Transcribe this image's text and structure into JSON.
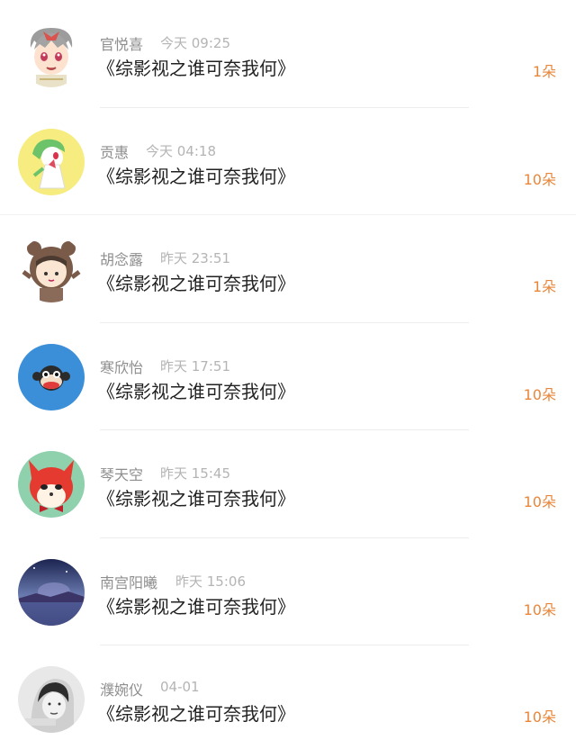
{
  "gifts": [
    {
      "name": "官悦喜",
      "time": "今天 09:25",
      "book": "《综影视之谁可奈我何》",
      "count": "1朵",
      "avatar": "anime-boy-avatar"
    },
    {
      "name": "贡惠",
      "time": "今天 04:18",
      "book": "《综影视之谁可奈我何》",
      "count": "10朵",
      "avatar": "pokemon-avatar"
    },
    {
      "name": "胡念露",
      "time": "昨天 23:51",
      "book": "《综影视之谁可奈我何》",
      "count": "1朵",
      "avatar": "bear-hood-girl-avatar"
    },
    {
      "name": "寒欣怡",
      "time": "昨天 17:51",
      "book": "《综影视之谁可奈我何》",
      "count": "10朵",
      "avatar": "monkey-avatar"
    },
    {
      "name": "琴天空",
      "time": "昨天 15:45",
      "book": "《综影视之谁可奈我何》",
      "count": "10朵",
      "avatar": "red-fox-avatar"
    },
    {
      "name": "南宫阳曦",
      "time": "昨天 15:06",
      "book": "《综影视之谁可奈我何》",
      "count": "10朵",
      "avatar": "night-landscape-avatar"
    },
    {
      "name": "濮婉仪",
      "time": "04-01",
      "book": "《综影视之谁可奈我何》",
      "count": "10朵",
      "avatar": "bw-portrait-avatar"
    }
  ],
  "colors": {
    "accent": "#e8863a",
    "name_text": "#8e8e8e",
    "time_text": "#b4b4b4",
    "title_text": "#222222"
  }
}
